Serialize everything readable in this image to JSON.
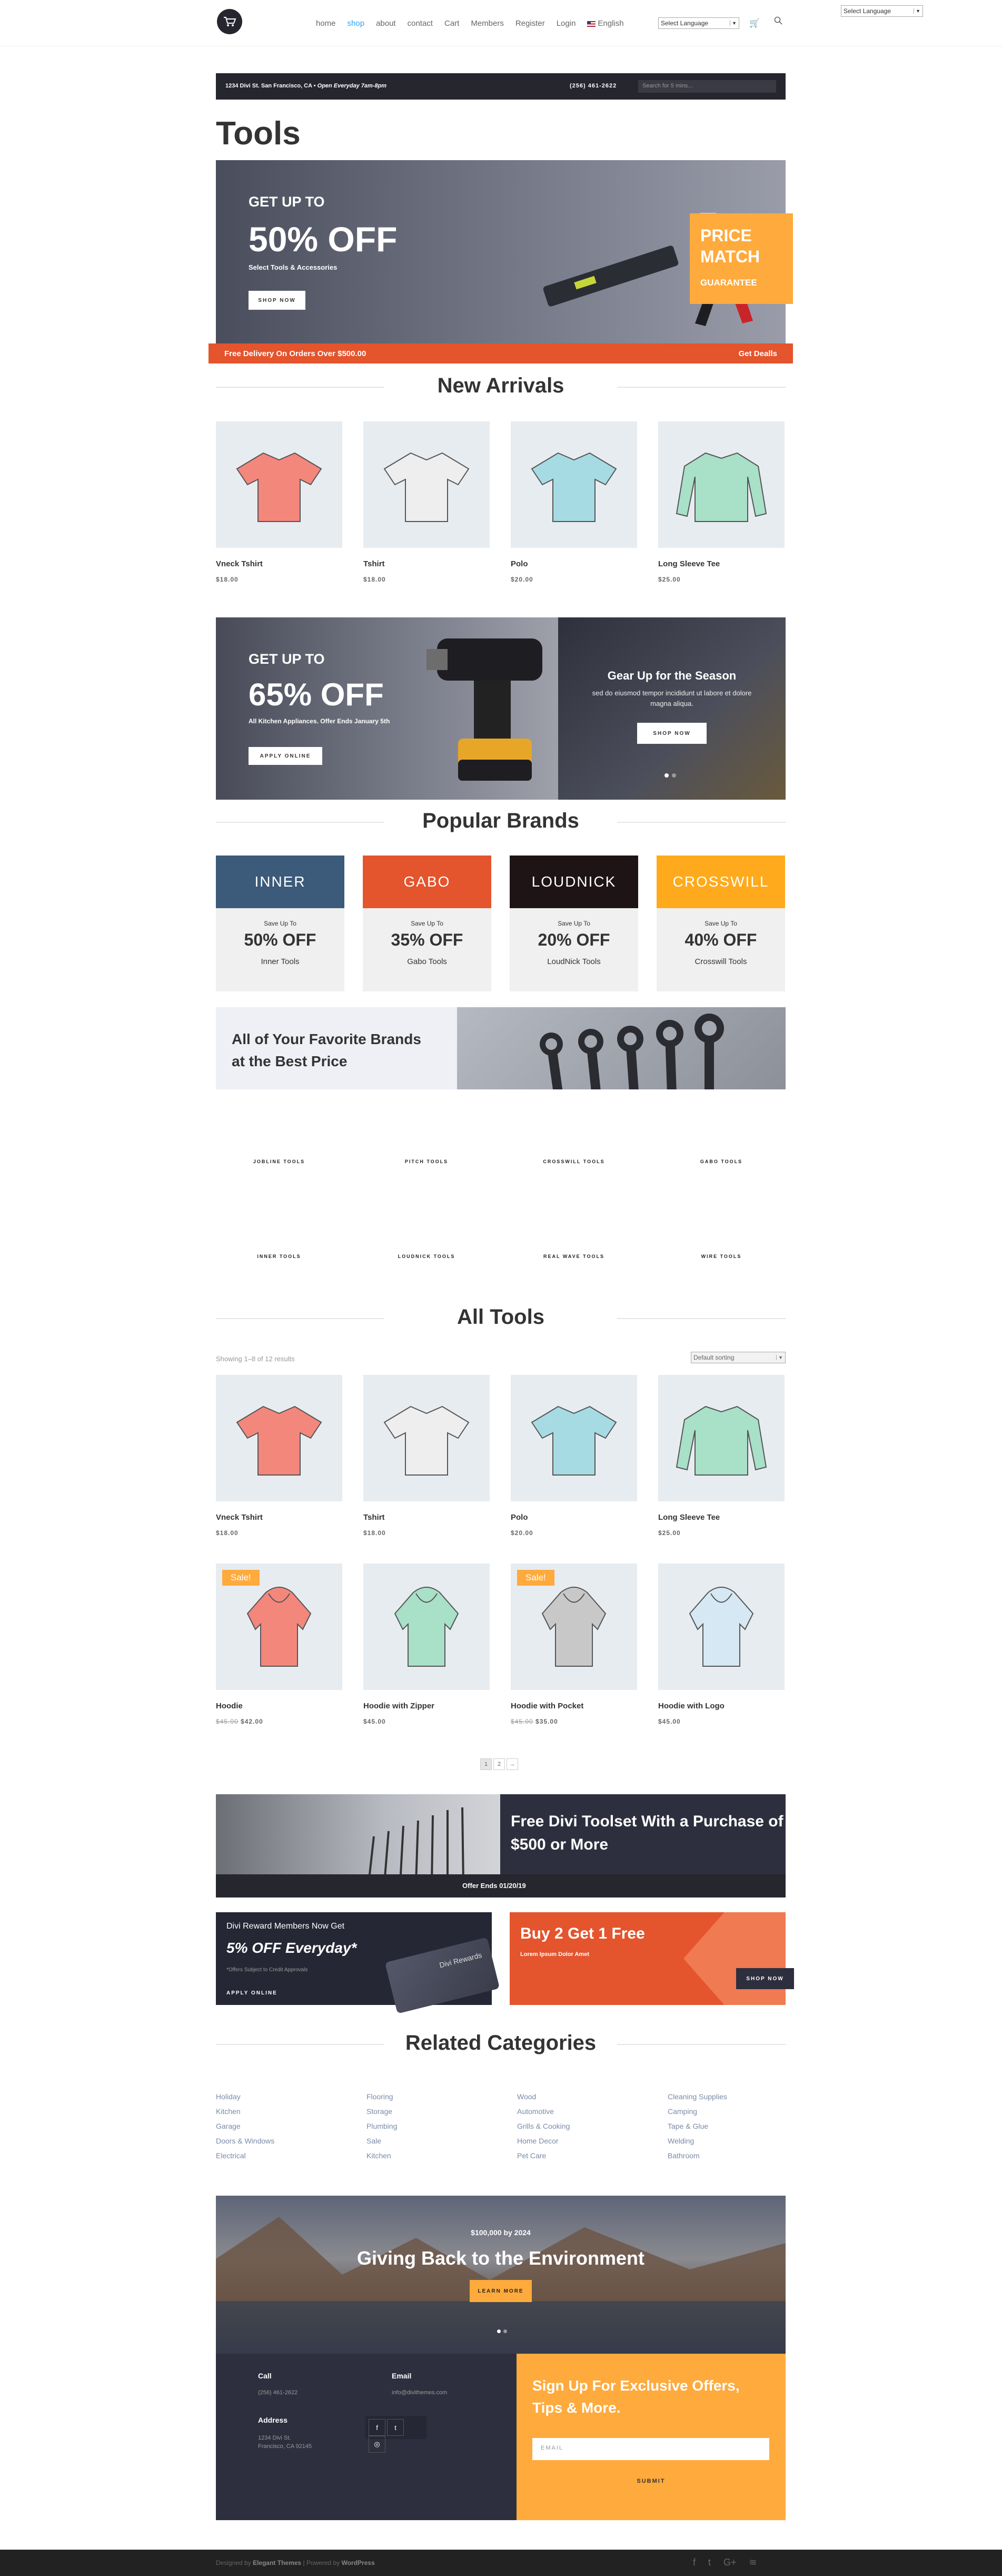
{
  "header": {
    "nav": [
      "home",
      "shop",
      "about",
      "contact",
      "Cart",
      "Members",
      "Register",
      "Login",
      "English"
    ],
    "active": "shop",
    "lang_select": "Select Language",
    "top_select": "Select Language"
  },
  "infobar": {
    "address": "1234 Divi St. San Francisco, CA •",
    "hours": "Open Everyday 7am-8pm",
    "phone": "(256) 461-2622",
    "search_placeholder": "Search for 5 mins..."
  },
  "page_title": "Tools",
  "hero": {
    "line1": "GET UP TO",
    "line2": "50% OFF",
    "line3": "Select Tools & Accessories",
    "button": "SHOP NOW",
    "badge_line1": "PRICE",
    "badge_line2": "MATCH",
    "badge_line3": "GUARANTEE",
    "strip_left": "Free Delivery On Orders Over $500.00",
    "strip_right": "Get Dealls"
  },
  "new_arrivals": {
    "title": "New Arrivals",
    "items": [
      {
        "name": "Vneck Tshirt",
        "price": "$18.00"
      },
      {
        "name": "Tshirt",
        "price": "$18.00"
      },
      {
        "name": "Polo",
        "price": "$20.00"
      },
      {
        "name": "Long Sleeve Tee",
        "price": "$25.00"
      }
    ]
  },
  "promo2": {
    "line1": "GET UP TO",
    "line2": "65% OFF",
    "line3": "All Kitchen Appliances. Offer Ends January 5th",
    "button": "APPLY ONLINE"
  },
  "slider": {
    "title": "Gear Up for the Season",
    "text": "sed do eiusmod tempor incididunt ut labore et dolore magna aliqua.",
    "button": "SHOP NOW"
  },
  "brands": {
    "title": "Popular Brands",
    "save": "Save Up To",
    "items": [
      {
        "logo": "INNER",
        "pct": "50% OFF",
        "name": "Inner Tools",
        "color": "#3c5a7a"
      },
      {
        "logo": "GABO",
        "pct": "35% OFF",
        "name": "Gabo Tools",
        "color": "#e4542d"
      },
      {
        "logo": "LOUDNICK",
        "pct": "20% OFF",
        "name": "LoudNick Tools",
        "color": "#1e1416"
      },
      {
        "logo": "CROSSWILL",
        "pct": "40% OFF",
        "name": "Crosswill Tools",
        "color": "#ffaa1c"
      }
    ]
  },
  "fav": {
    "line1": "All of Your Favorite Brands",
    "line2": "at the Best Price"
  },
  "brand_links": [
    "JOBLINE TOOLS",
    "PITCH TOOLS",
    "CROSSWILL TOOLS",
    "GABO TOOLS",
    "INNER TOOLS",
    "LOUDNICK TOOLS",
    "REAL WAVE TOOLS",
    "WIRE TOOLS"
  ],
  "all_tools": {
    "title": "All Tools",
    "count": "Showing 1–8 of 12 results",
    "sort": "Default sorting",
    "sale": "Sale!",
    "items": [
      {
        "name": "Vneck Tshirt",
        "price": "$18.00"
      },
      {
        "name": "Tshirt",
        "price": "$18.00"
      },
      {
        "name": "Polo",
        "price": "$20.00"
      },
      {
        "name": "Long Sleeve Tee",
        "price": "$25.00"
      },
      {
        "name": "Hoodie",
        "old": "$45.00",
        "price": "$42.00"
      },
      {
        "name": "Hoodie with Zipper",
        "price": "$45.00"
      },
      {
        "name": "Hoodie with Pocket",
        "old": "$45.00",
        "price": "$35.00"
      },
      {
        "name": "Hoodie with Logo",
        "price": "$45.00"
      }
    ],
    "pages": [
      "1",
      "2",
      "→"
    ]
  },
  "divi_promo": {
    "line1": "Free Divi Toolset With a Purchase of",
    "line2": "$500 or More",
    "ends": "Offer Ends 01/20/19"
  },
  "reward": {
    "line1": "Divi Reward Members Now Get",
    "line2": "5% OFF Everyday*",
    "note": "*Offers Subject to Credit Approvals",
    "button": "APPLY ONLINE",
    "card": "Divi Rewards"
  },
  "buy2": {
    "title": "Buy 2 Get 1 Free",
    "text": "Lorem Ipsum Dolor Amet",
    "button": "SHOP NOW"
  },
  "related": {
    "title": "Related Categories",
    "cols": [
      [
        "Holiday",
        "Kitchen",
        "Garage",
        "Doors & Windows",
        "Electrical"
      ],
      [
        "Flooring",
        "Storage",
        "Plumbing",
        "Sale",
        "Kitchen"
      ],
      [
        "Wood",
        "Automotive",
        "Grills & Cooking",
        "Home Decor",
        "Pet Care"
      ],
      [
        "Cleaning Supplies",
        "Camping",
        "Tape & Glue",
        "Welding",
        "Bathroom"
      ]
    ]
  },
  "env": {
    "small": "$100,000 by 2024",
    "title": "Giving Back to the Environment",
    "button": "LEARN MORE"
  },
  "footer": {
    "call_label": "Call",
    "call": "(256) 461-2622",
    "email_label": "Email",
    "email": "info@divithemes.com",
    "addr_label": "Address",
    "addr1": "1234 Divi St.",
    "addr2": "Francisco, CA 92145"
  },
  "subscribe": {
    "line1": "Sign Up For Exclusive Offers,",
    "line2": "Tips & More.",
    "placeholder": "EMAIL",
    "button": "SUBMIT"
  },
  "bottom": {
    "text1": "Designed by",
    "brand": "Elegant Themes",
    "text2": "| Powered by",
    "wp": "WordPress"
  }
}
